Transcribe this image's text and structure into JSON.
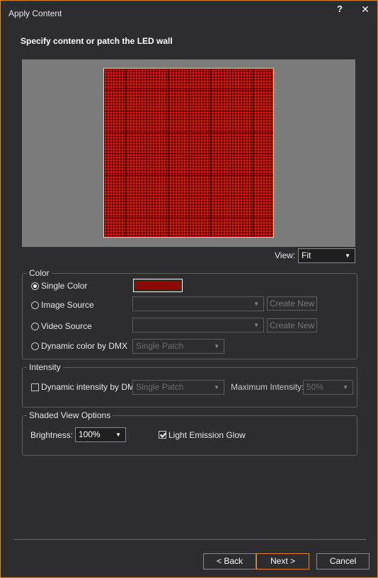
{
  "window": {
    "title": "Apply Content",
    "help_glyph": "?",
    "close_glyph": "✕"
  },
  "subtitle": "Specify content or patch the LED wall",
  "preview": {
    "content_color": "#8b0c06"
  },
  "view": {
    "label": "View:",
    "value": "Fit"
  },
  "color_group": {
    "label": "Color",
    "single_color": {
      "label": "Single Color",
      "selected": true,
      "swatch": "#8b0c06"
    },
    "image_source": {
      "label": "Image Source",
      "value": "",
      "create_new": "Create New"
    },
    "video_source": {
      "label": "Video Source",
      "value": "",
      "create_new": "Create New"
    },
    "dynamic_dmx": {
      "label": "Dynamic color by DMX",
      "value": "Single Patch"
    }
  },
  "intensity_group": {
    "label": "Intensity",
    "dynamic_dmx": {
      "label": "Dynamic intensity by DMX",
      "checked": false,
      "value": "Single Patch"
    },
    "max_intensity": {
      "label": "Maximum Intensity:",
      "value": "50%"
    }
  },
  "shaded_group": {
    "label": "Shaded View Options",
    "brightness": {
      "label": "Brightness:",
      "value": "100%"
    },
    "glow": {
      "label": "Light Emission Glow",
      "checked": true
    }
  },
  "footer": {
    "back": "< Back",
    "next": "Next >",
    "cancel": "Cancel"
  },
  "colors": {
    "accent": "#e08a22",
    "background": "#2d2d30"
  }
}
